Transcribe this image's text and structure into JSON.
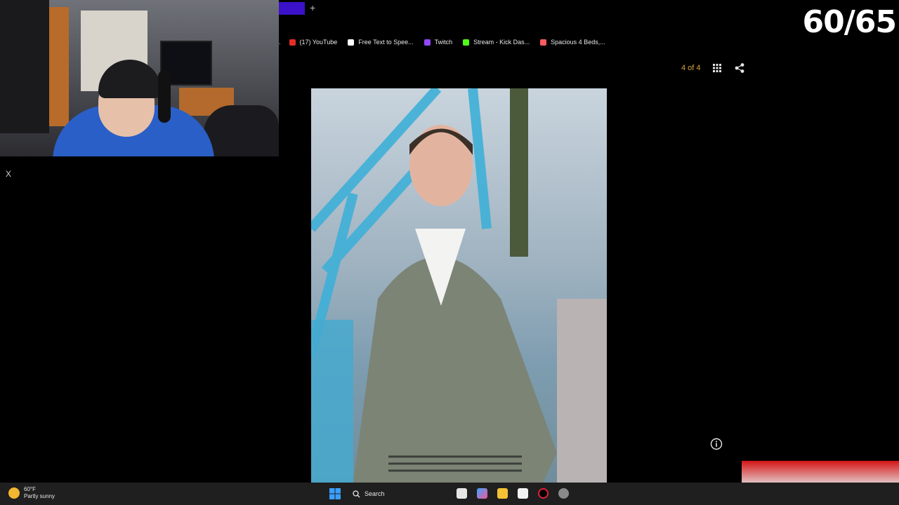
{
  "stream": {
    "counter": "60/65"
  },
  "browser": {
    "bookmarks": [
      {
        "label": "(17) YouTube",
        "icon": "youtube-icon",
        "color": "#e52d27"
      },
      {
        "label": "Free Text to Spee...",
        "icon": "document-icon",
        "color": "#ffffff"
      },
      {
        "label": "Twitch",
        "icon": "twitch-icon",
        "color": "#9147ff"
      },
      {
        "label": "Stream - Kick Das...",
        "icon": "kick-icon",
        "color": "#53fc18"
      },
      {
        "label": "Spacious 4 Beds,...",
        "icon": "airbnb-icon",
        "color": "#ff5a5f"
      }
    ],
    "new_tab_symbol": "+",
    "side_icon": "X"
  },
  "viewer": {
    "page_indicator": "4 of 4",
    "accent_color": "#d9a23a"
  },
  "taskbar": {
    "weather_temp": "60°F",
    "weather_desc": "Partly sunny",
    "search_label": "Search"
  }
}
